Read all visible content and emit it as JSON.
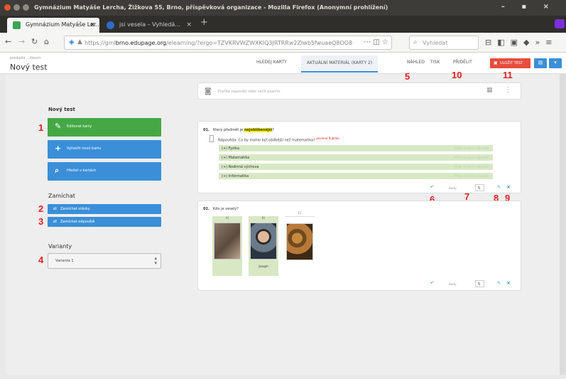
{
  "window": {
    "title": "Gymnázium Matyáše Lercha, Žižkova 55, Brno, příspěvková organizace - Mozilla Firefox (Anonymní prohlížení)",
    "controls": "– ▪ ×"
  },
  "tabs": [
    {
      "label": "Gymnázium Matyáše Ler...",
      "color": "#3aa556"
    },
    {
      "label": "jsi vesela – Vyhledá...",
      "color": "#2d6cc8"
    }
  ],
  "nav": {
    "url_prefix": "https://gml",
    "url_host": "brno.edupage.org",
    "url_path": "/elearning/?ergo=TZVKRVWZWXKIQ3JRTRRw2ZIwb5fwuaeQ8OO8",
    "search_placeholder": "Vyhledat"
  },
  "header": {
    "crumb": "predošlá ...ítkostr",
    "title": "Nový test",
    "nav_items": [
      "HLEDEJ KARTY",
      "AKTUÁLNÍ MATERIÁL (KARTY 2)",
      "NÁHLED",
      "TISK",
      "PŘIDĚLIT"
    ],
    "red_button": "ULOŽIT TEST"
  },
  "sidebar": {
    "title": "Nový test",
    "buttons": [
      "Editovat karty",
      "Vytvořit novú kartu",
      "Hledat v kartách"
    ],
    "shuffle_label": "Zamíchat",
    "shuffle_buttons": [
      "Zamíchat otázky",
      "Zamíchat odpovědi"
    ],
    "variants_label": "Varianty",
    "variant_selected": "Varianta 1"
  },
  "search_card": {
    "placeholder": "Pozříte nápověd nebo začit psaním"
  },
  "question1": {
    "number": "01.",
    "text_before": "Který předmět je ",
    "highlight": "nejoblíbenější",
    "text_after": "?",
    "hint": "Nápověda: Co by mohlo být oblíbější než matematika?",
    "hint_note": "povinná Rubrika",
    "answers": [
      "(+) Fyzika",
      "(+) Matematika",
      "(+) Rodinná výchova",
      "(+) Informatika"
    ],
    "answer_tag": "Přidat správné odpovědi",
    "points_label": "Body:",
    "points": "5"
  },
  "question2": {
    "number": "02.",
    "text": "Kdo je veselý?",
    "columns": [
      "A)",
      "B)",
      "C)"
    ],
    "captions": [
      "",
      "Joseph",
      ""
    ],
    "points_label": "Body:",
    "points": "5"
  },
  "markers": [
    "1",
    "2",
    "3",
    "4",
    "5",
    "6",
    "7",
    "8",
    "9",
    "10",
    "11"
  ]
}
